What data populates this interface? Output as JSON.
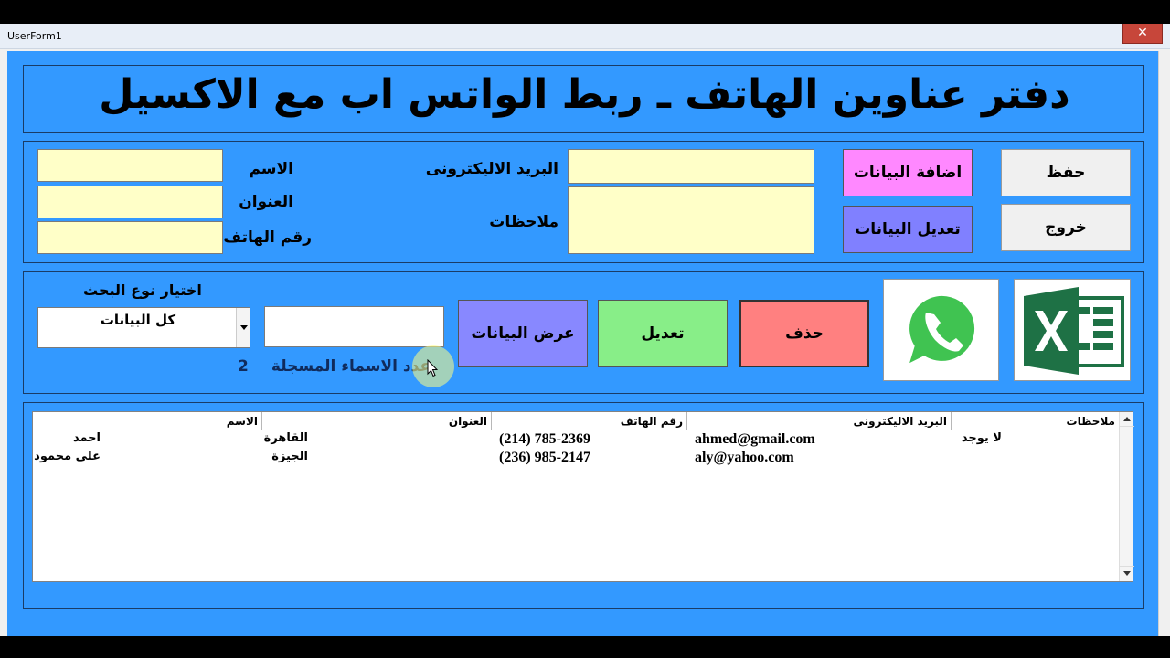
{
  "window": {
    "title": "UserForm1",
    "close_glyph": "✕"
  },
  "header": {
    "title": "دفتر عناوين الهاتف ـ ربط الواتس اب مع الاكسيل"
  },
  "form": {
    "labels": {
      "name": "الاسم",
      "address": "العنوان",
      "phone": "رقم الهاتف",
      "email": "البريد الاليكترونى",
      "notes": "ملاحظات"
    },
    "values": {
      "name": "",
      "address": "",
      "phone": "",
      "email": "",
      "notes": ""
    }
  },
  "buttons": {
    "add": "اضافة البيانات",
    "save": "حفظ",
    "edit_data": "تعديل البيانات",
    "exit": "خروج",
    "view": "عرض البيانات",
    "edit": "تعديل",
    "delete": "حذف"
  },
  "search": {
    "type_label": "اختيار نوع البحث",
    "type_value": "كل البيانات",
    "query": "",
    "count_label": "عدد الاسماء المسجلة",
    "count_value": "2"
  },
  "icons": {
    "whatsapp": "whatsapp-icon",
    "excel": "excel-icon"
  },
  "colors": {
    "form_bg": "#3399ff",
    "add_btn": "#ff88ff",
    "edit_data_btn": "#8080ff",
    "view_btn": "#8888ff",
    "edit_btn": "#88ee88",
    "delete_btn": "#ff8080",
    "field_bg": "#ffffc8"
  },
  "table": {
    "columns": [
      "الاسم",
      "العنوان",
      "رقم الهاتف",
      "البريد الاليكترونى",
      "ملاحظات"
    ],
    "rows": [
      {
        "name": "احمد",
        "address": "القاهرة",
        "phone": "(214) 785-2369",
        "email": "ahmed@gmail.com",
        "notes": "لا يوجد"
      },
      {
        "name": "على محمود",
        "address": "الجيزة",
        "phone": "(236) 985-2147",
        "email": "aly@yahoo.com",
        "notes": ""
      }
    ]
  }
}
